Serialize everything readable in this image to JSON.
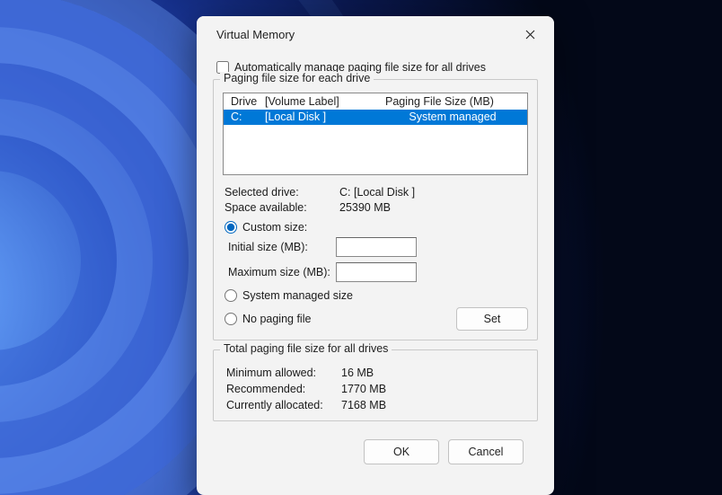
{
  "window": {
    "title": "Virtual Memory"
  },
  "auto_manage": {
    "label": "Automatically manage paging file size for all drives",
    "checked": false
  },
  "drive_section": {
    "legend": "Paging file size for each drive",
    "header_drive": "Drive",
    "header_volume": "[Volume Label]",
    "header_size": "Paging File Size (MB)",
    "rows": [
      {
        "drive": "C:",
        "volume": "[Local Disk ]",
        "size": "System managed"
      }
    ],
    "selected_drive_label": "Selected drive:",
    "selected_drive_value": "C:  [Local Disk ]",
    "space_available_label": "Space available:",
    "space_available_value": "25390 MB",
    "custom_size_label": "Custom size:",
    "initial_label": "Initial size (MB):",
    "initial_value": "",
    "max_label": "Maximum size (MB):",
    "max_value": "",
    "system_managed_label": "System managed size",
    "no_paging_label": "No paging file",
    "set_button": "Set",
    "size_mode": "custom"
  },
  "totals": {
    "legend": "Total paging file size for all drives",
    "min_label": "Minimum allowed:",
    "min_value": "16 MB",
    "rec_label": "Recommended:",
    "rec_value": "1770 MB",
    "cur_label": "Currently allocated:",
    "cur_value": "7168 MB"
  },
  "footer": {
    "ok": "OK",
    "cancel": "Cancel"
  }
}
